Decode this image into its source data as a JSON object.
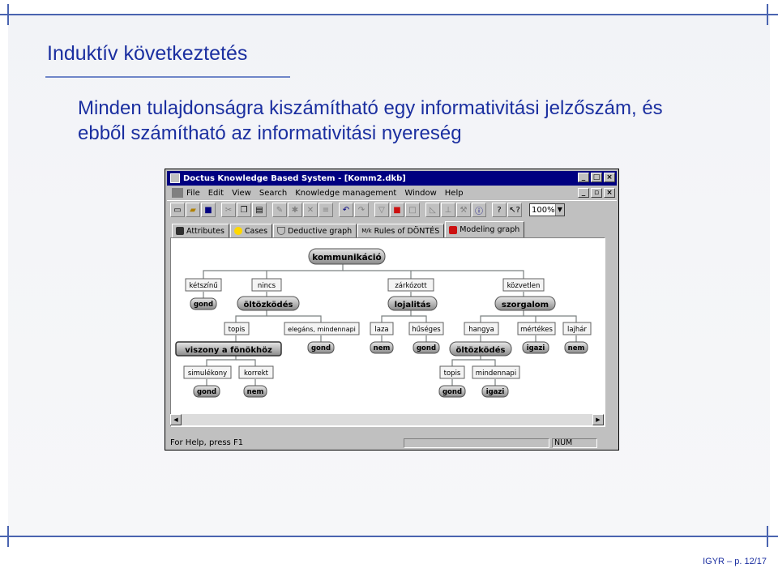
{
  "slide": {
    "title": "Induktív következtetés",
    "body": "Minden tulajdonságra kiszámítható egy informativitási jelzőszám, és ebből számítható az informativitási nyereség",
    "footer": "IGYR – p. 12/17"
  },
  "window": {
    "title": "Doctus Knowledge Based System - [Komm2.dkb]",
    "menu": [
      "File",
      "Edit",
      "View",
      "Search",
      "Knowledge management",
      "Window",
      "Help"
    ],
    "zoom": "100%",
    "tabs": [
      {
        "label": "Attributes",
        "icon": "attributes-icon",
        "color": "#404040"
      },
      {
        "label": "Cases",
        "icon": "cases-icon",
        "color": "#ffd800"
      },
      {
        "label": "Deductive graph",
        "icon": "deductive-graph-icon",
        "color": "#e8e8e8"
      },
      {
        "label": "Rules of DÖNTÉS",
        "icon": "rules-icon",
        "color": "#808080"
      },
      {
        "label": "Modeling graph",
        "icon": "modeling-graph-icon",
        "color": "#cc1010",
        "active": true
      }
    ],
    "status": {
      "help": "For Help, press F1",
      "num": "NUM"
    }
  },
  "tree": {
    "root": "kommunikáció",
    "values": {
      "ketszinu": "kétszínű",
      "nincs": "nincs",
      "zarkozott": "zárkózott",
      "kozvetlen": "közvetlen",
      "topis1": "topis",
      "elegans": "elegáns, mindennapi",
      "laza": "laza",
      "huseges": "hűséges",
      "hangya": "hangya",
      "mertekes": "mértékes",
      "lajhar": "lajhár",
      "simulekony": "simulékony",
      "korrekt": "korrekt",
      "topis2": "topis",
      "mindennapi": "mindennapi"
    },
    "attributes": {
      "oltozkodes1": "öltözködés",
      "lojalitas": "lojalitás",
      "szorgalom": "szorgalom",
      "viszony": "viszony a fönökhöz",
      "oltozkodes2": "öltözködés"
    },
    "outcomes": {
      "gond1": "gond",
      "gond2": "gond",
      "nem1": "nem",
      "gond3": "gond",
      "igazi1": "igazi",
      "nem2": "nem",
      "gond4": "gond",
      "nem3": "nem",
      "gond5": "gond",
      "igazi2": "igazi"
    }
  }
}
